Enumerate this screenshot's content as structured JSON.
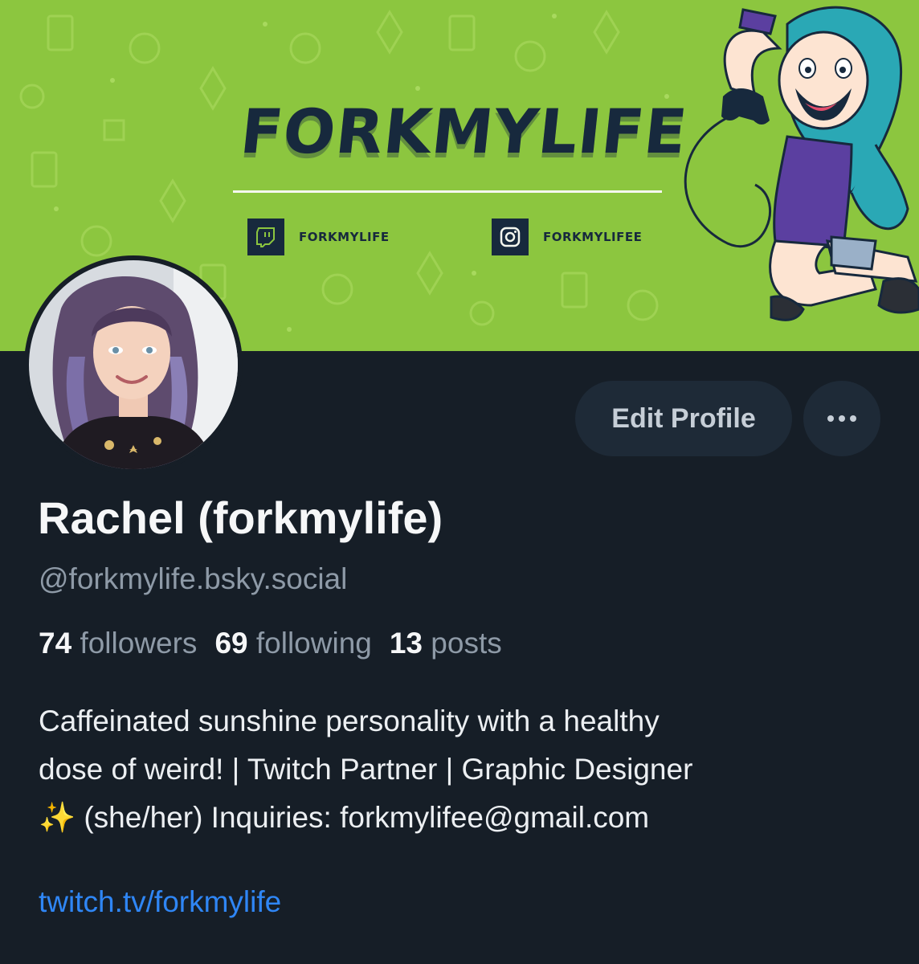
{
  "banner": {
    "title": "FORKMYLIFE",
    "twitch_label": "FORKMYLIFE",
    "instagram_label": "FORKMYLIFEE",
    "background_color": "#8cc63f",
    "ink_color": "#17293d"
  },
  "avatar": {
    "icon": "avatar-photo"
  },
  "actions": {
    "edit_label": "Edit Profile",
    "more_icon": "ellipsis-icon"
  },
  "profile": {
    "display_name": "Rachel (forkmylife)",
    "handle": "@forkmylife.bsky.social",
    "stats": {
      "followers_count": "74",
      "followers_label": "followers",
      "following_count": "69",
      "following_label": "following",
      "posts_count": "13",
      "posts_label": "posts"
    },
    "bio_lines": [
      "Caffeinated sunshine personality with a healthy",
      "dose of weird! | Twitch Partner | Graphic Designer",
      "✨ (she/her) Inquiries: forkmylifee@gmail.com"
    ],
    "link": "twitch.tv/forkmylife"
  },
  "colors": {
    "page_bg": "#161e27",
    "button_bg": "#1e2a37",
    "muted_text": "#8e9aa7",
    "link": "#2f86f5"
  }
}
